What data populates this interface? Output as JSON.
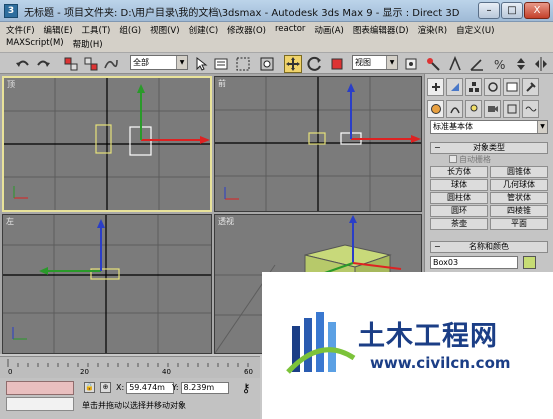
{
  "window": {
    "title": "无标题    - 项目文件夹: D:\\用户目录\\我的文档\\3dsmax    - Autodesk 3ds Max 9    - 显示 : Direct 3D",
    "app_icon_letter": "3",
    "minimize": "–",
    "maximize": "□",
    "close": "X"
  },
  "menus": {
    "row1": [
      "文件(F)",
      "编辑(E)",
      "工具(T)",
      "组(G)",
      "视图(V)",
      "创建(C)",
      "修改器(O)",
      "reactor",
      "动画(A)",
      "图表编辑器(D)",
      "渲染(R)",
      "自定义(U)"
    ],
    "row2": [
      "MAXScript(M)",
      "帮助(H)"
    ]
  },
  "toolbar": {
    "selection_filter": "全部",
    "view_dropdown": "视图"
  },
  "viewports": {
    "top_left": {
      "label": "顶"
    },
    "top_right": {
      "label": "前"
    },
    "bottom_left": {
      "label": "左"
    },
    "bottom_right": {
      "label": "透视"
    }
  },
  "command_panel": {
    "category": "标准基本体",
    "object_type_header": "对象类型",
    "autogrid": "自动栅格",
    "buttons": [
      "长方体",
      "圆锥体",
      "球体",
      "几何球体",
      "圆柱体",
      "管状体",
      "圆环",
      "四棱锥",
      "茶壶",
      "平面"
    ],
    "name_color_header": "名称和颜色",
    "object_name": "Box03",
    "object_color": "#c6dc74"
  },
  "timeline": {
    "ticks": [
      "0",
      "20",
      "40",
      "60"
    ]
  },
  "status": {
    "x_label": "X:",
    "x_value": "59.474m",
    "y_label": "Y:",
    "y_value": "8.239m",
    "prompt": "单击并拖动以选择并移动对象"
  },
  "watermark": {
    "title": "土木工程网",
    "url": "www.civilcn.com"
  }
}
